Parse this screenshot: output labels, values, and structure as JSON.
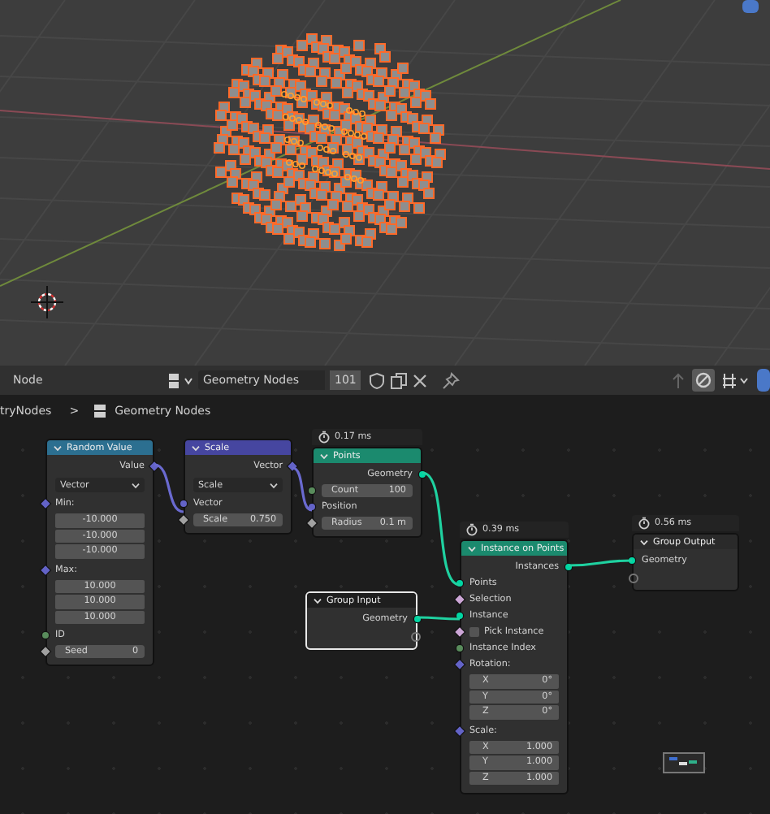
{
  "header": {
    "editor": "Node",
    "node_group": "Geometry Nodes",
    "users": "101"
  },
  "breadcrumb": {
    "items": [
      "tryNodes",
      "Geometry Nodes"
    ],
    "separator": ">"
  },
  "nodes": [
    {
      "title": "Random Value",
      "color": "#2c6f90",
      "selected": false,
      "rows": [
        {
          "kind": "output",
          "label": "Value",
          "field": true,
          "color": "#6363c7"
        },
        {
          "kind": "dropdown",
          "value": "Vector"
        },
        {
          "kind": "input",
          "label": "Min:",
          "field": true,
          "color": "#6363c7"
        },
        {
          "kind": "vector",
          "components": [
            {
              "value": "-10.000"
            },
            {
              "value": "-10.000"
            },
            {
              "value": "-10.000"
            }
          ]
        },
        {
          "kind": "input",
          "label": "Max:",
          "field": true,
          "color": "#6363c7"
        },
        {
          "kind": "vector",
          "components": [
            {
              "value": "10.000"
            },
            {
              "value": "10.000"
            },
            {
              "value": "10.000"
            }
          ]
        },
        {
          "kind": "input",
          "label": "ID",
          "field": false,
          "color": "#598c5c"
        },
        {
          "kind": "field",
          "label": "Seed",
          "value": "0",
          "field": true,
          "color": "#a1a1a1"
        }
      ]
    },
    {
      "title": "Scale",
      "color": "#4646a0",
      "selected": false,
      "rows": [
        {
          "kind": "output",
          "label": "Vector",
          "field": true,
          "color": "#6363c7"
        },
        {
          "kind": "dropdown",
          "value": "Scale"
        },
        {
          "kind": "input",
          "label": "Vector",
          "field": false,
          "color": "#6363c7"
        },
        {
          "kind": "field",
          "label": "Scale",
          "value": "0.750",
          "field": true,
          "color": "#a1a1a1"
        }
      ]
    },
    {
      "title": "Points",
      "color": "#1b8a6e",
      "selected": false,
      "time": "0.17 ms",
      "rows": [
        {
          "kind": "output",
          "label": "Geometry",
          "field": false,
          "color": "#00d6a3"
        },
        {
          "kind": "field",
          "label": "Count",
          "value": "100",
          "field": false,
          "color": "#598c5c"
        },
        {
          "kind": "input",
          "label": "Position",
          "field": false,
          "color": "#6363c7"
        },
        {
          "kind": "field",
          "label": "Radius",
          "value": "0.1 m",
          "field": true,
          "color": "#a1a1a1"
        }
      ]
    },
    {
      "title": "Group Input",
      "color": "#1e1e1e",
      "selected": true,
      "rows": [
        {
          "kind": "output",
          "label": "Geometry",
          "field": false,
          "color": "#00d6a3"
        },
        {
          "kind": "virtual_out"
        }
      ]
    },
    {
      "title": "Instance on Points",
      "color": "#1b8a6e",
      "selected": false,
      "time": "0.39 ms",
      "rows": [
        {
          "kind": "output",
          "label": "Instances",
          "field": false,
          "color": "#00d6a3"
        },
        {
          "kind": "input",
          "label": "Points",
          "field": false,
          "color": "#00d6a3"
        },
        {
          "kind": "input",
          "label": "Selection",
          "field": true,
          "color": "#cca6d6"
        },
        {
          "kind": "input",
          "label": "Instance",
          "field": false,
          "color": "#00d6a3"
        },
        {
          "kind": "checkbox",
          "label": "Pick Instance",
          "checked": false,
          "field": true,
          "color": "#cca6d6"
        },
        {
          "kind": "input",
          "label": "Instance Index",
          "field": false,
          "color": "#598c5c"
        },
        {
          "kind": "input",
          "label": "Rotation:",
          "field": true,
          "color": "#6363c7"
        },
        {
          "kind": "vector",
          "components": [
            {
              "label": "X",
              "value": "0°"
            },
            {
              "label": "Y",
              "value": "0°"
            },
            {
              "label": "Z",
              "value": "0°"
            }
          ]
        },
        {
          "kind": "input",
          "label": "Scale:",
          "field": true,
          "color": "#6363c7"
        },
        {
          "kind": "vector",
          "components": [
            {
              "label": "X",
              "value": "1.000"
            },
            {
              "label": "Y",
              "value": "1.000"
            },
            {
              "label": "Z",
              "value": "1.000"
            }
          ]
        }
      ]
    },
    {
      "title": "Group Output",
      "color": "#2a2a2a",
      "selected": false,
      "time": "0.56 ms",
      "rows": [
        {
          "kind": "input",
          "label": "Geometry",
          "field": false,
          "color": "#00d6a3"
        },
        {
          "kind": "virtual_in"
        }
      ]
    }
  ]
}
